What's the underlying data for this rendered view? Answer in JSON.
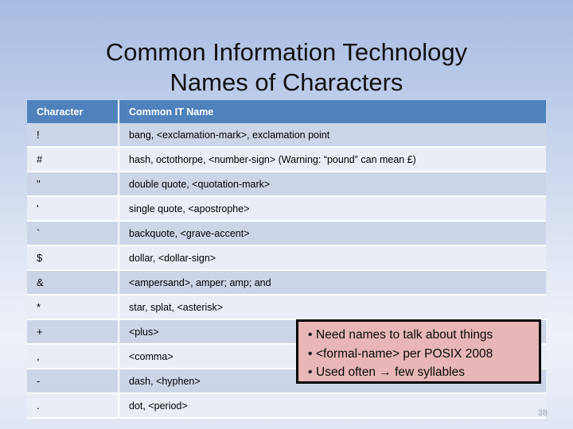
{
  "slide": {
    "title_line1": "Common Information Technology",
    "title_line2": "Names of Characters",
    "page_number": "38",
    "colors": {
      "background_top": "#a7bce3",
      "background_bottom": "#dfe5f2",
      "header_blue": "#4f81bd",
      "row_dark": "#ccd5e8",
      "row_light": "#e9edf6",
      "callout_fill": "#e8b6b6",
      "callout_border": "#000000",
      "page_number_color": "#9aa6bd"
    }
  },
  "table": {
    "columns": [
      "Character",
      "Common IT Name"
    ],
    "rows": [
      {
        "character": "!",
        "name": "bang, <exclamation-mark>, exclamation point"
      },
      {
        "character": "#",
        "name": "hash, octothorpe, <number-sign> (Warning:  “pound” can mean £)"
      },
      {
        "character": "\"",
        "name": "double quote, <quotation-mark>"
      },
      {
        "character": "'",
        "name": "single quote, <apostrophe>"
      },
      {
        "character": "`",
        "name": "backquote, <grave-accent>"
      },
      {
        "character": "$",
        "name": "dollar, <dollar-sign>"
      },
      {
        "character": "&",
        "name": "<ampersand>, amper; amp; and"
      },
      {
        "character": "*",
        "name": "star, splat, <asterisk>"
      },
      {
        "character": "+",
        "name": "<plus>"
      },
      {
        "character": ",",
        "name": "<comma>"
      },
      {
        "character": "-",
        "name": "dash, <hyphen>"
      },
      {
        "character": ".",
        "name": "dot, <period>"
      }
    ]
  },
  "callout": {
    "bullets": [
      "Need names to talk about things",
      "<formal-name> per POSIX 2008",
      "Used often → few syllables"
    ]
  }
}
